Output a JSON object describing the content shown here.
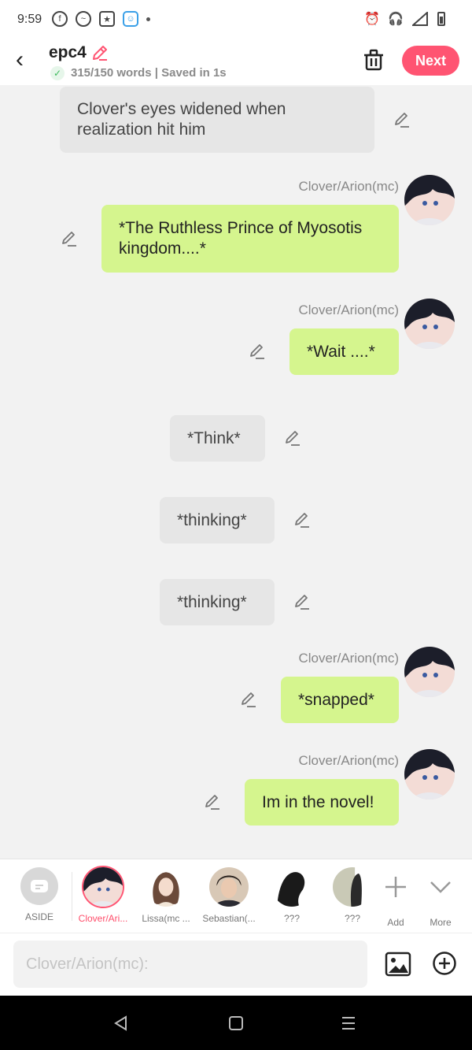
{
  "status_bar": {
    "time": "9:59"
  },
  "header": {
    "title": "epc4",
    "word_count": "315/150 words | Saved in 1s",
    "next_label": "Next"
  },
  "messages": [
    {
      "type": "narration",
      "text": "Clover's eyes widened when realization hit him"
    },
    {
      "type": "character",
      "name": "Clover/Arion(mc)",
      "text": "*The Ruthless Prince of Myosotis kingdom....*"
    },
    {
      "type": "character",
      "name": "Clover/Arion(mc)",
      "text": "*Wait ....*"
    },
    {
      "type": "narration",
      "text": "*Think*"
    },
    {
      "type": "narration",
      "text": "*thinking*"
    },
    {
      "type": "narration",
      "text": "*thinking*"
    },
    {
      "type": "character",
      "name": "Clover/Arion(mc)",
      "text": "*snapped*"
    },
    {
      "type": "character",
      "name": "Clover/Arion(mc)",
      "text": "Im in the novel!"
    }
  ],
  "character_bar": {
    "aside_label": "ASIDE",
    "characters": [
      {
        "label": "Clover/Ari...",
        "active": true
      },
      {
        "label": "Lissa(mc ..."
      },
      {
        "label": "Sebastian(..."
      },
      {
        "label": "???"
      },
      {
        "label": "???"
      }
    ],
    "add_label": "Add",
    "more_label": "More"
  },
  "input": {
    "placeholder": "Clover/Arion(mc):"
  },
  "colors": {
    "accent": "#ff5472",
    "bubble_green": "#d5f58e",
    "bubble_grey": "#e6e6e6"
  }
}
